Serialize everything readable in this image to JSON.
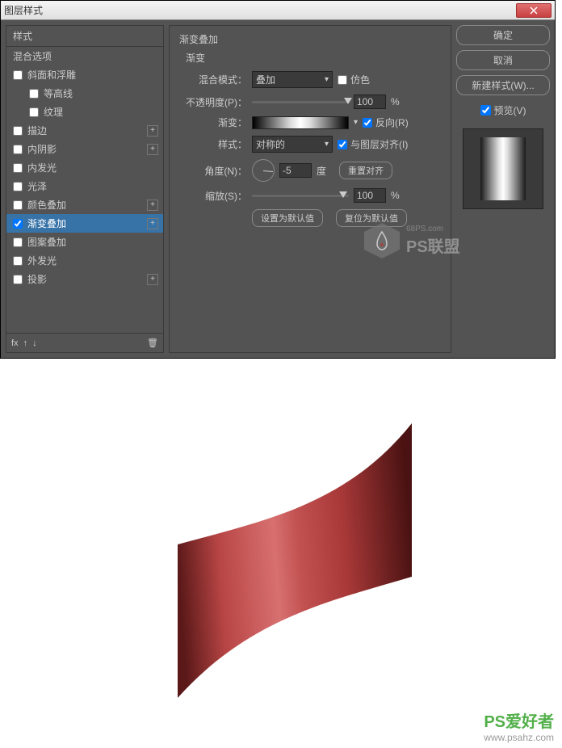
{
  "dialog": {
    "title": "图层样式",
    "styles_header": "样式",
    "blending_options": "混合选项",
    "items": [
      {
        "label": "斜面和浮雕",
        "checked": false,
        "plus": false
      },
      {
        "label": "等高线",
        "checked": false,
        "indent": true
      },
      {
        "label": "纹理",
        "checked": false,
        "indent": true
      },
      {
        "label": "描边",
        "checked": false,
        "plus": true
      },
      {
        "label": "内阴影",
        "checked": false,
        "plus": true
      },
      {
        "label": "内发光",
        "checked": false
      },
      {
        "label": "光泽",
        "checked": false
      },
      {
        "label": "颜色叠加",
        "checked": false,
        "plus": true
      },
      {
        "label": "渐变叠加",
        "checked": true,
        "selected": true,
        "plus": true
      },
      {
        "label": "图案叠加",
        "checked": false
      },
      {
        "label": "外发光",
        "checked": false
      },
      {
        "label": "投影",
        "checked": false,
        "plus": true
      }
    ],
    "footer_fx": "fx"
  },
  "settings": {
    "section": "渐变叠加",
    "subsection": "渐变",
    "blend_mode_label": "混合模式：",
    "blend_mode_value": "叠加",
    "dither_label": "仿色",
    "dither_checked": false,
    "opacity_label": "不透明度(P)：",
    "opacity_value": "100",
    "percent": "%",
    "gradient_label": "渐变：",
    "reverse_label": "反向(R)",
    "reverse_checked": true,
    "style_label": "样式：",
    "style_value": "对称的",
    "align_label": "与图层对齐(I)",
    "align_checked": true,
    "angle_label": "角度(N)：",
    "angle_value": "-5",
    "angle_unit": "度",
    "reset_align": "重置对齐",
    "scale_label": "缩放(S)：",
    "scale_value": "100",
    "set_default": "设置为默认值",
    "reset_default": "复位为默认值"
  },
  "actions": {
    "ok": "确定",
    "cancel": "取消",
    "new_style": "新建样式(W)...",
    "preview_label": "预览(V)",
    "preview_checked": true
  },
  "watermark": {
    "site": "68PS.com",
    "name": "PS联盟"
  },
  "result_wm": {
    "brand_ps": "PS",
    "brand_rest": "爱好者",
    "url": "www.psahz.com"
  }
}
